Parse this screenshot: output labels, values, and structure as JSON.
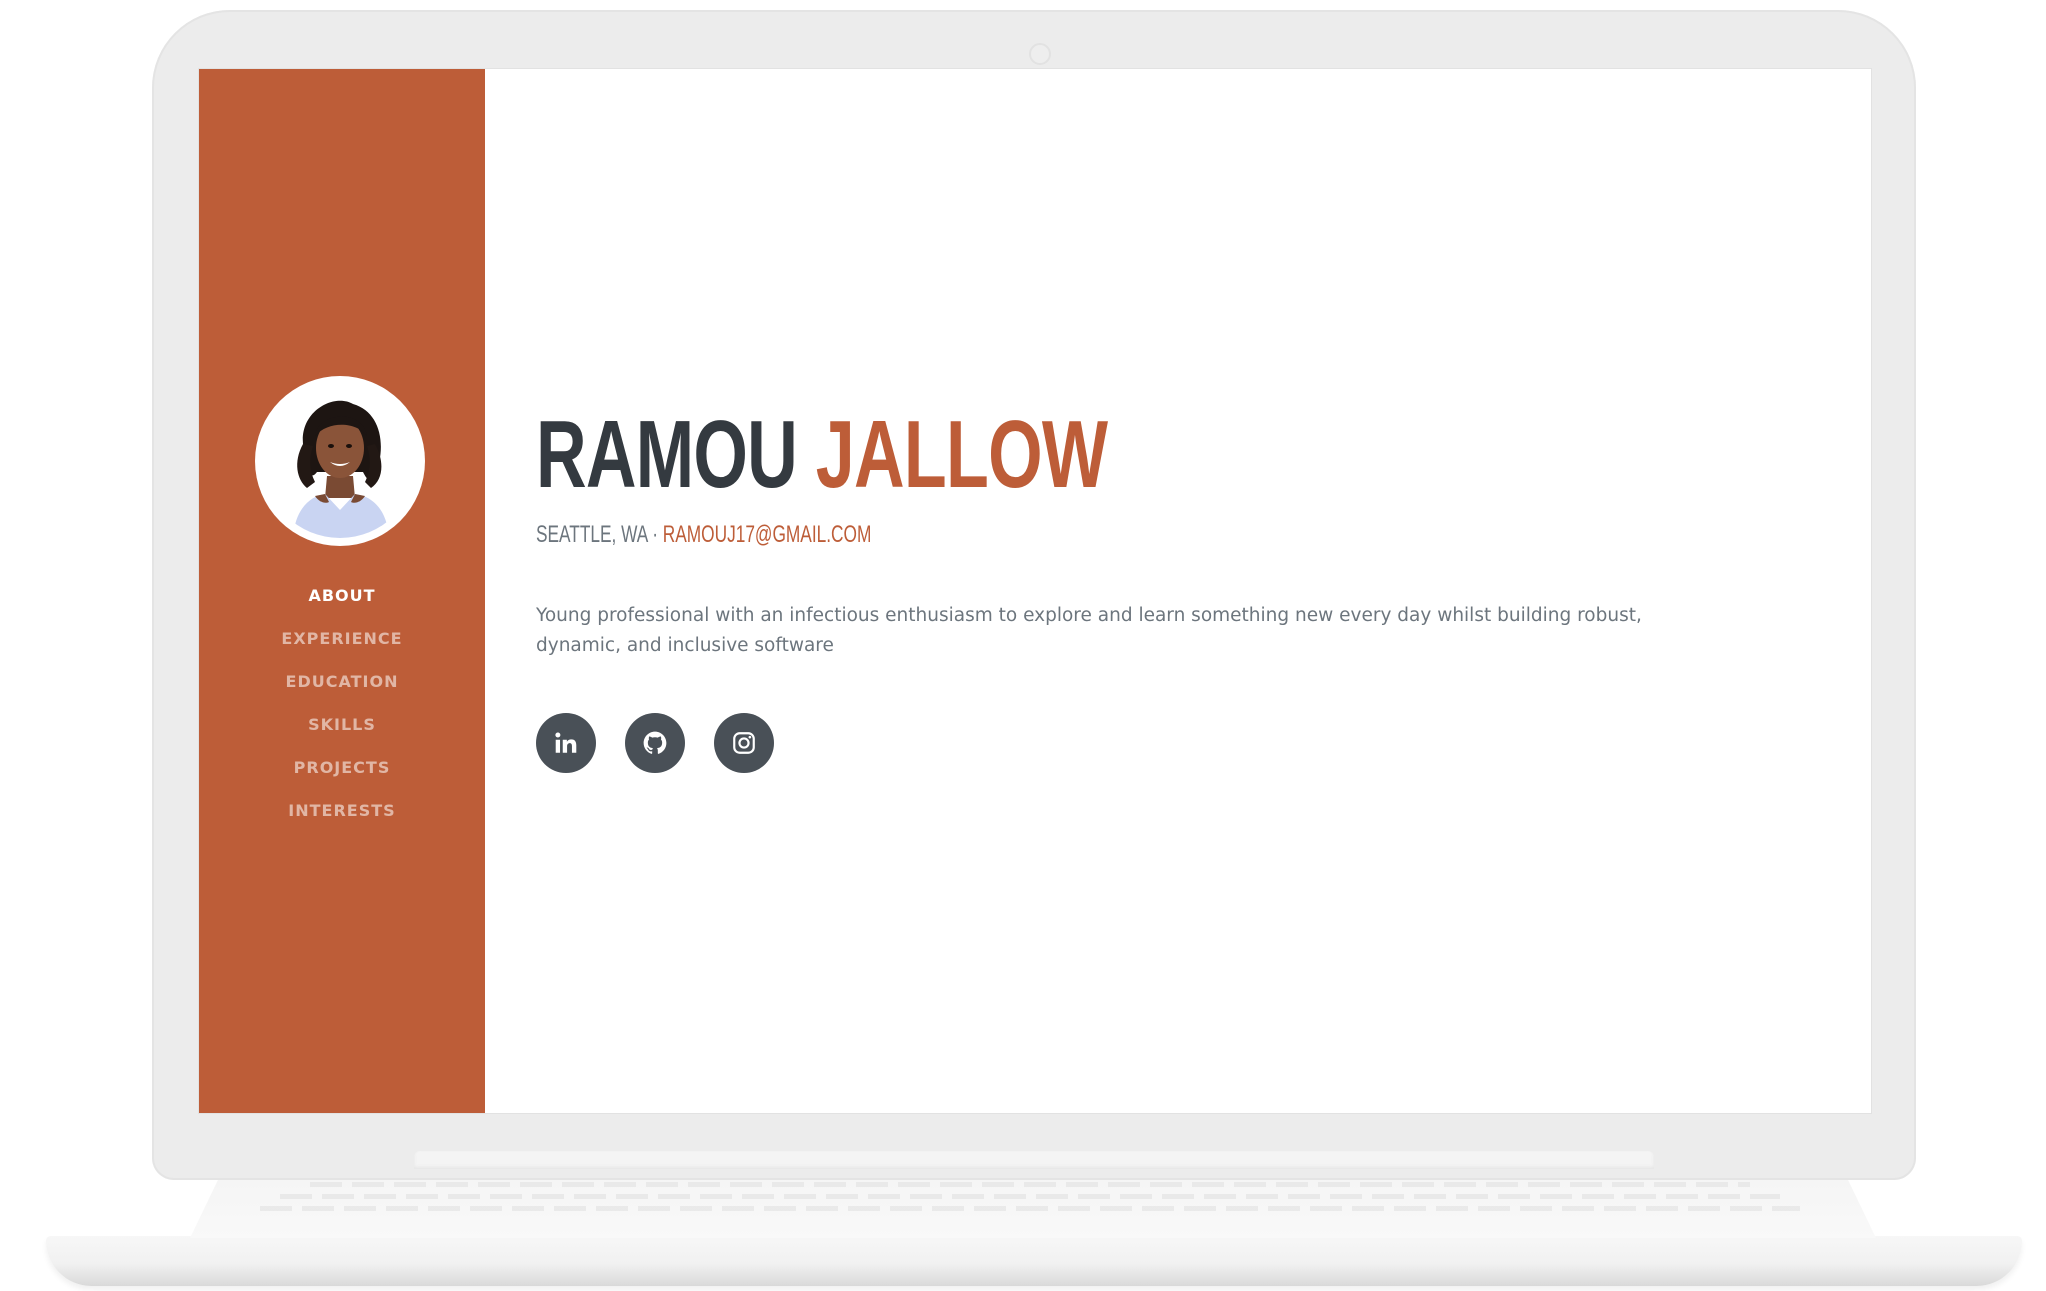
{
  "sidebar": {
    "avatar_alt": "profile photo",
    "nav": [
      {
        "label": "ABOUT",
        "active": true
      },
      {
        "label": "EXPERIENCE",
        "active": false
      },
      {
        "label": "EDUCATION",
        "active": false
      },
      {
        "label": "SKILLS",
        "active": false
      },
      {
        "label": "PROJECTS",
        "active": false
      },
      {
        "label": "INTERESTS",
        "active": false
      }
    ]
  },
  "about": {
    "first_name": "RAMOU",
    "last_name": "JALLOW",
    "location": "SEATTLE, WA",
    "separator": "·",
    "email": "RAMOUJ17@GMAIL.COM",
    "bio": "Young professional with an infectious enthusiasm to explore and learn something new every day whilst building robust, dynamic, and inclusive software"
  },
  "social": [
    {
      "name": "linkedin",
      "icon": "linkedin-icon"
    },
    {
      "name": "github",
      "icon": "github-icon"
    },
    {
      "name": "instagram",
      "icon": "instagram-icon"
    }
  ],
  "colors": {
    "primary": "#bd5d38",
    "heading": "#343a40",
    "muted": "#6c757d",
    "social_bg": "#495057",
    "laptop": "#ececec"
  }
}
